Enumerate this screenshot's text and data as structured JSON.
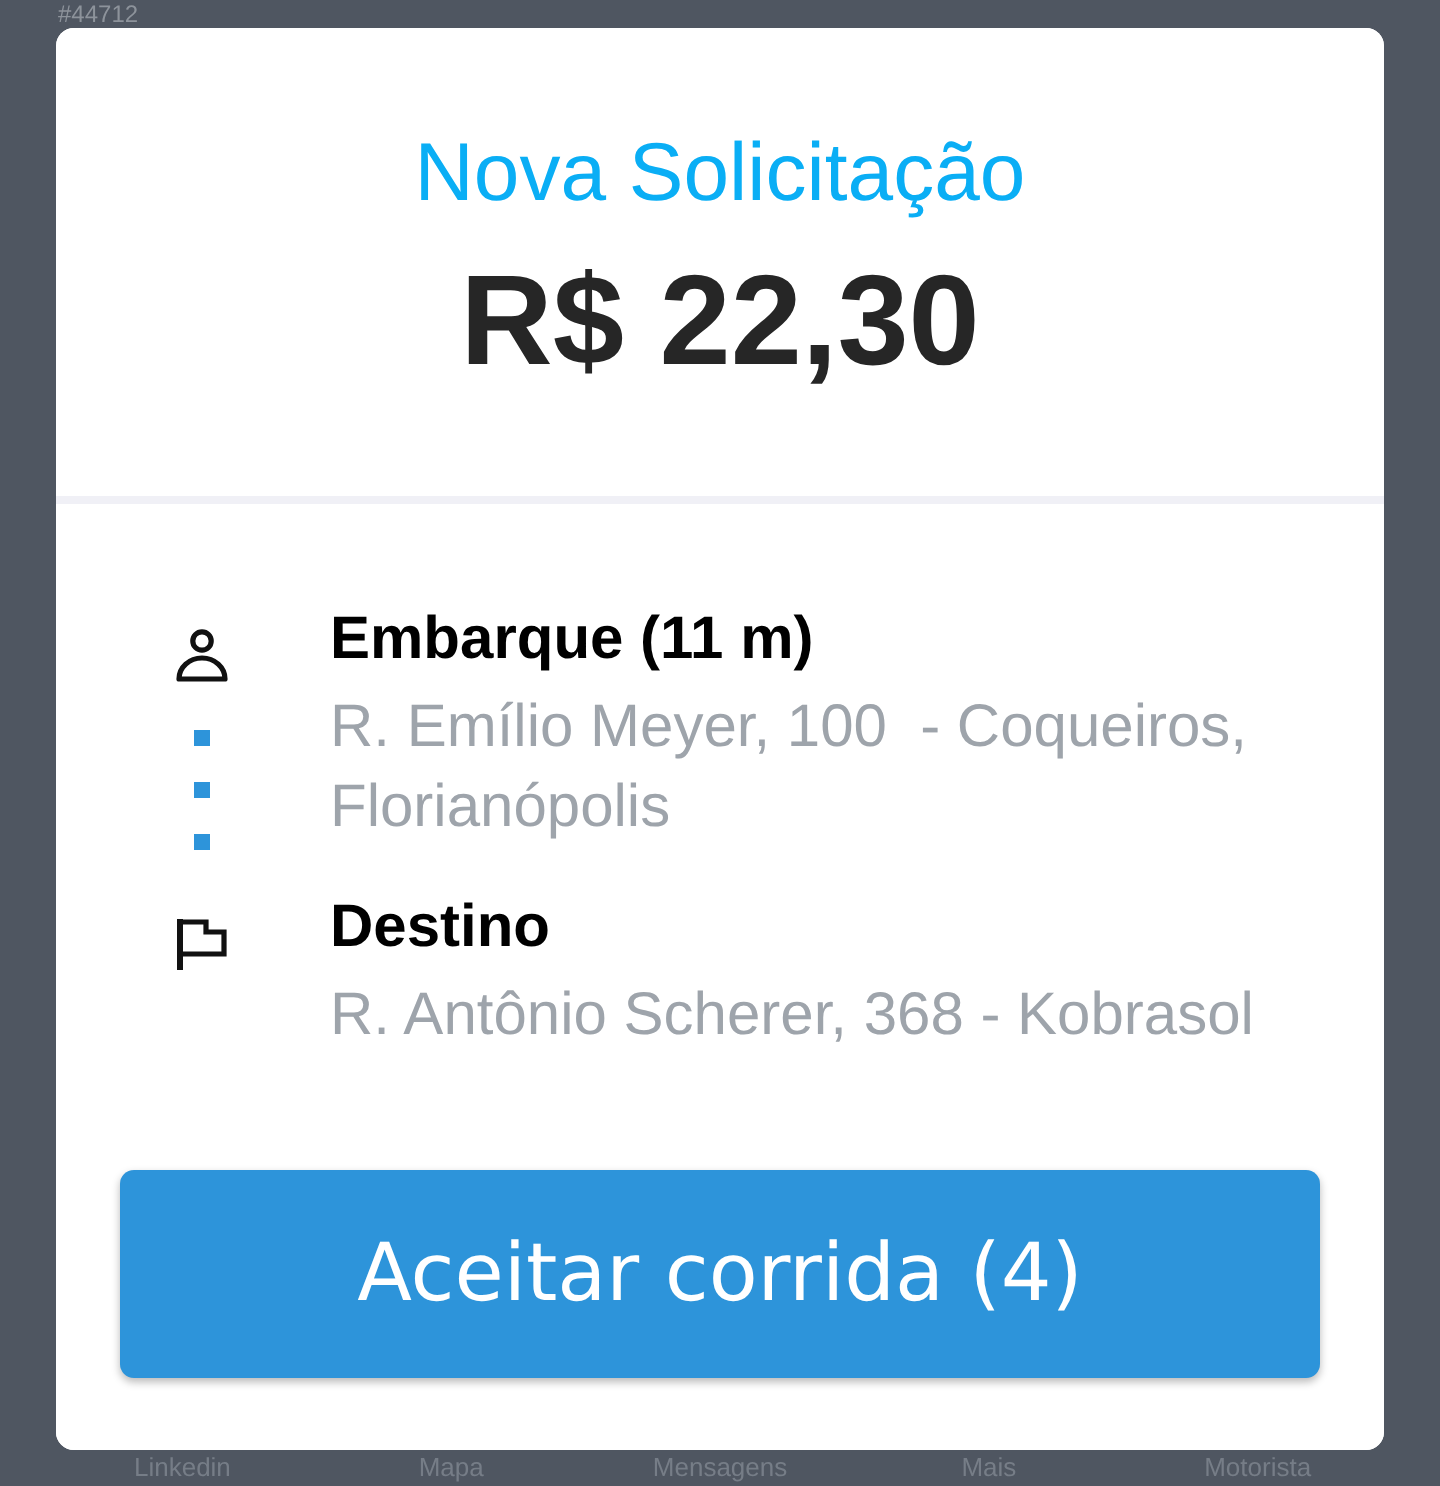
{
  "background": {
    "order_number": "#44712",
    "nav_items": [
      "Linkedin",
      "Mapa",
      "Mensagens",
      "Mais",
      "Motorista"
    ]
  },
  "modal": {
    "title": "Nova Solicitação",
    "fare": "R$ 22,30",
    "stops": [
      {
        "kind": "pickup",
        "label": "Embarque (11 m)",
        "address": "R. Emílio Meyer, 100  - Coqueiros, Florianópolis"
      },
      {
        "kind": "destination",
        "label": "Destino",
        "address": "R. Antônio Scherer, 368 - Kobrasol"
      }
    ],
    "accept_button": "Aceitar corrida (4)"
  }
}
